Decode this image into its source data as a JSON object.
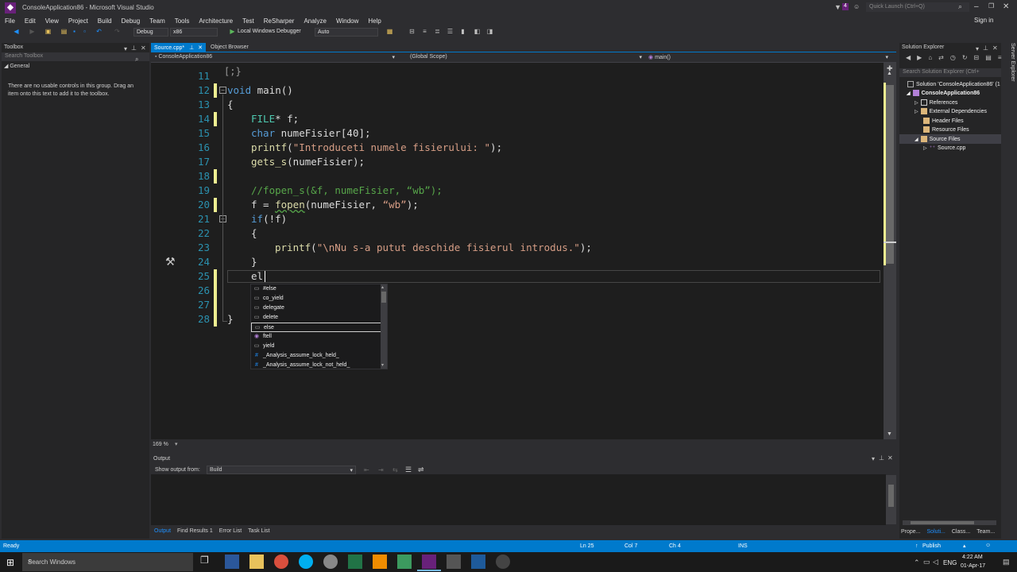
{
  "window": {
    "title": "ConsoleApplication86 - Microsoft Visual Studio",
    "quick_launch": "Quick Launch (Ctrl+Q)",
    "sign_in": "Sign in",
    "notif_count": "4"
  },
  "menu": [
    "File",
    "Edit",
    "View",
    "Project",
    "Build",
    "Debug",
    "Team",
    "Tools",
    "Architecture",
    "Test",
    "ReSharper",
    "Analyze",
    "Window",
    "Help"
  ],
  "toolbar": {
    "config": "Debug",
    "platform": "x86",
    "debugger": "Local Windows Debugger",
    "mode": "Auto"
  },
  "toolbox": {
    "title": "Toolbox",
    "search_placeholder": "Search Toolbox",
    "group": "General",
    "empty_note": "There are no usable controls in this group. Drag an item onto this text to add it to the toolbox."
  },
  "tabs": [
    {
      "label": "Source.cpp*",
      "active": true
    },
    {
      "label": "Object Browser",
      "active": false
    }
  ],
  "nav": {
    "project": "ConsoleApplication86",
    "scope": "(Global Scope)",
    "member": "main()"
  },
  "editor": {
    "lines": [
      {
        "num": "11"
      },
      {
        "num": "12"
      },
      {
        "num": "13"
      },
      {
        "num": "14"
      },
      {
        "num": "15"
      },
      {
        "num": "16"
      },
      {
        "num": "17"
      },
      {
        "num": "18"
      },
      {
        "num": "19"
      },
      {
        "num": "20"
      },
      {
        "num": "21"
      },
      {
        "num": "22"
      },
      {
        "num": "23"
      },
      {
        "num": "24"
      },
      {
        "num": "25"
      },
      {
        "num": "26"
      },
      {
        "num": "27"
      },
      {
        "num": "28"
      }
    ],
    "code": {
      "l12_kw": "void",
      "l12_rest": " main()",
      "l13": "{",
      "l14_ty": "FILE",
      "l14_rest": "* f;",
      "l15_kw": "char",
      "l15_rest": " numeFisier[40];",
      "l16_fn": "printf",
      "l16_open": "(",
      "l16_str": "\"Introduceti numele fisierului: \"",
      "l16_close": ");",
      "l17_fn": "gets_s",
      "l17_rest": "(numeFisier);",
      "l19_cmt": "//fopen_s(&f, numeFisier, “wb”);",
      "l20_a": "f = ",
      "l20_fn": "fopen",
      "l20_b": "(numeFisier, ",
      "l20_str": "“wb”",
      "l20_c": ");",
      "l21_kw": "if",
      "l21_rest": "(!f)",
      "l22": "{",
      "l23_fn": "printf",
      "l23_open": "(",
      "l23_str": "\"\\nNu s-a putut deschide fisierul introdus.\"",
      "l23_close": ");",
      "l24": "}",
      "l25": "el",
      "l28": "}"
    },
    "zoom": "169 %"
  },
  "autocomplete": {
    "items": [
      "#else",
      "co_yield",
      "delegate",
      "delete",
      "else",
      "ftell",
      "yield",
      "_Analysis_assume_lock_held_",
      "_Analysis_assume_lock_not_held_"
    ],
    "selected_index": 4
  },
  "output": {
    "title": "Output",
    "show_from_label": "Show output from:",
    "source": "Build"
  },
  "bottom_tabs": [
    "Output",
    "Find Results 1",
    "Error List",
    "Task List"
  ],
  "solution_explorer": {
    "title": "Solution Explorer",
    "search_placeholder": "Search Solution Explorer (Ctrl+",
    "tree": [
      {
        "label": "Solution 'ConsoleApplication86' (1",
        "depth": 0
      },
      {
        "label": "ConsoleApplication86",
        "depth": 1
      },
      {
        "label": "References",
        "depth": 2
      },
      {
        "label": "External Dependencies",
        "depth": 2
      },
      {
        "label": "Header Files",
        "depth": 2
      },
      {
        "label": "Resource Files",
        "depth": 2
      },
      {
        "label": "Source Files",
        "depth": 2
      },
      {
        "label": "Source.cpp",
        "depth": 3
      }
    ],
    "bottom_tabs": [
      "Prope...",
      "Soluti...",
      "Class...",
      "Team..."
    ],
    "side_label": "Server Explorer"
  },
  "status": {
    "ready": "Ready",
    "line": "Ln 25",
    "col": "Col 7",
    "ch": "Ch 4",
    "ins": "INS",
    "publish": "Publish"
  },
  "taskbar": {
    "search": "Search Windows",
    "lang": "ENG",
    "time": "4:22 AM",
    "date": "01-Apr-17"
  }
}
